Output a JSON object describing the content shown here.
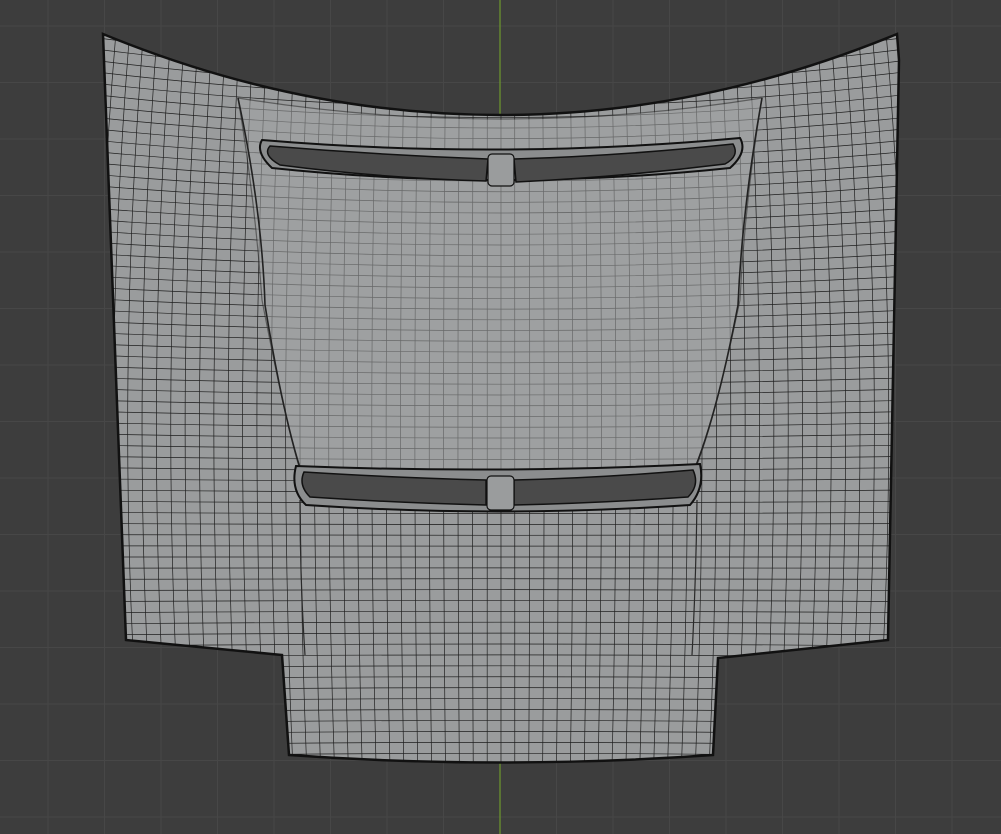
{
  "viewport": {
    "background_color": "#3d3d3d",
    "grid_color": "#474747",
    "axis_color": "#6e9a2d",
    "mesh_fill_color": "#9a9c9d",
    "mesh_wire_color": "#1f1f1f",
    "vent_opening_color": "#4a4a4a",
    "object_outline_color": "#111111"
  },
  "scene": {
    "object": "car-hood-mesh",
    "display_mode": "wireframe-on-shaded",
    "view": "top-orthographic"
  }
}
